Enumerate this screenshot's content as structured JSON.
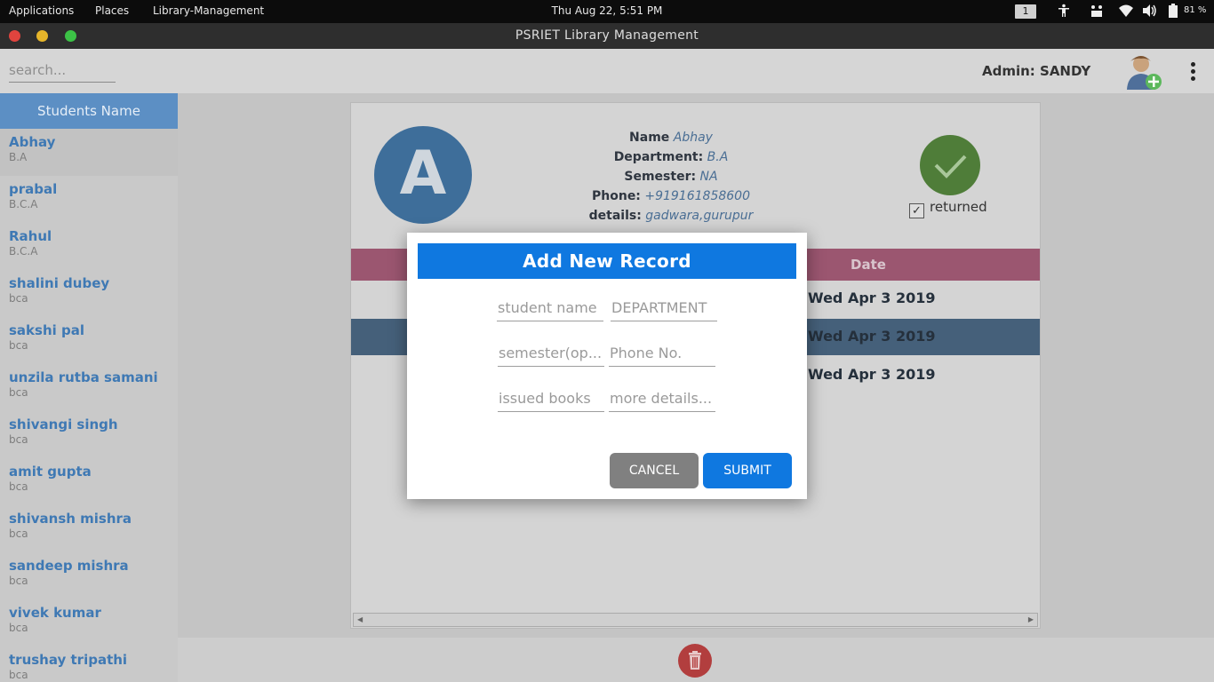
{
  "topbar": {
    "applications": "Applications",
    "places": "Places",
    "app_menu": "Library-Management",
    "clock": "Thu Aug 22,  5:51 PM",
    "workspace": "1",
    "battery": "81 %"
  },
  "window": {
    "title": "PSRIET Library Management"
  },
  "appbar": {
    "search_placeholder": "search...",
    "admin_label": "Admin: SANDY"
  },
  "sidebar": {
    "header": "Students Name",
    "students": [
      {
        "name": "Abhay",
        "dept": "B.A"
      },
      {
        "name": "prabal",
        "dept": "B.C.A"
      },
      {
        "name": "Rahul",
        "dept": "B.C.A"
      },
      {
        "name": "shalini dubey",
        "dept": "bca"
      },
      {
        "name": "sakshi pal",
        "dept": "bca"
      },
      {
        "name": "unzila rutba samani",
        "dept": "bca"
      },
      {
        "name": "shivangi singh",
        "dept": "bca"
      },
      {
        "name": "amit gupta",
        "dept": "bca"
      },
      {
        "name": "shivansh mishra",
        "dept": "bca"
      },
      {
        "name": "sandeep mishra",
        "dept": "bca"
      },
      {
        "name": "vivek kumar",
        "dept": "bca"
      },
      {
        "name": "trushay tripathi",
        "dept": "bca"
      }
    ]
  },
  "profile": {
    "initial": "A",
    "name_label": "Name",
    "name": "Abhay",
    "department_label": "Department:",
    "department": "B.A",
    "semester_label": "Semester:",
    "semester": "NA",
    "phone_label": "Phone:",
    "phone": "+919161858600",
    "details_label": "details:",
    "details": "gadwara,gurupur",
    "returned_label": "returned",
    "returned_check": "✓"
  },
  "table": {
    "date_header": "Date",
    "rows": [
      "Wed Apr 3 2019",
      "Wed Apr 3 2019",
      "Wed Apr 3 2019"
    ]
  },
  "modal": {
    "title": "Add New Record",
    "fields": {
      "student_name": "student name",
      "department": "DEPARTMENT",
      "semester": "semester(op...",
      "phone": "Phone No.",
      "issued_books": "issued books",
      "more_details": "more details..."
    },
    "cancel_label": "CANCEL",
    "submit_label": "SUBMIT"
  },
  "colors": {
    "accent": "#0f78e0",
    "sidebar_header": "#5c8fc4",
    "table_header": "#9b5670",
    "returned_ok": "#4f7d39",
    "delete": "#b23e3e"
  }
}
